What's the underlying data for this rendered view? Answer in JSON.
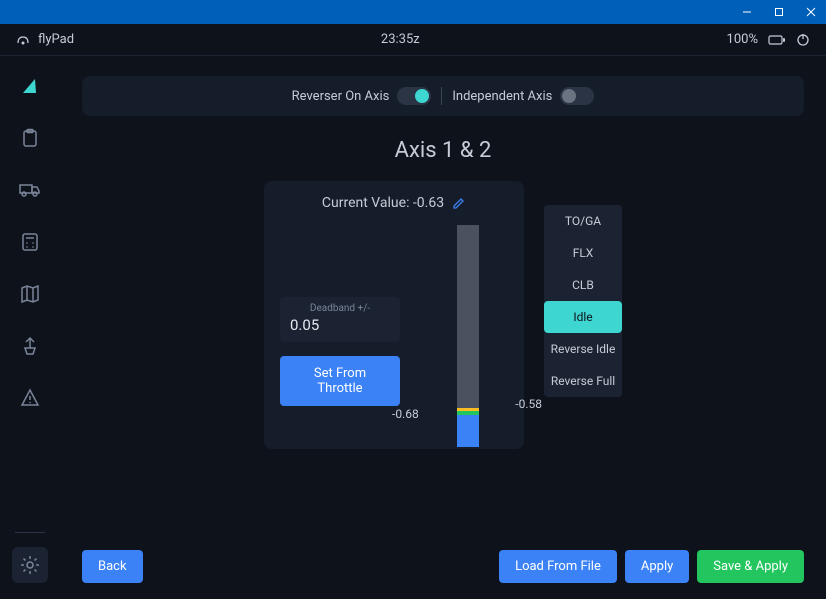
{
  "titlebar": {
    "minimize": "—",
    "maximize": "☐",
    "close": "✕"
  },
  "topbar": {
    "app_name": "flyPad",
    "time": "23:35z",
    "battery_pct": "100%"
  },
  "toggles": {
    "reverser_label": "Reverser On Axis",
    "independent_label": "Independent Axis"
  },
  "axis": {
    "title": "Axis 1 & 2",
    "current_value_label": "Current Value: -0.63",
    "deadband_label": "Deadband +/-",
    "deadband_value": "0.05",
    "set_from_throttle": "Set From Throttle",
    "gauge_left": "-0.68",
    "gauge_right": "-0.58"
  },
  "detents": {
    "items": [
      "TO/GA",
      "FLX",
      "CLB",
      "Idle",
      "Reverse Idle",
      "Reverse Full"
    ],
    "active_index": 3
  },
  "buttons": {
    "back": "Back",
    "load": "Load From File",
    "apply": "Apply",
    "save_apply": "Save & Apply"
  }
}
